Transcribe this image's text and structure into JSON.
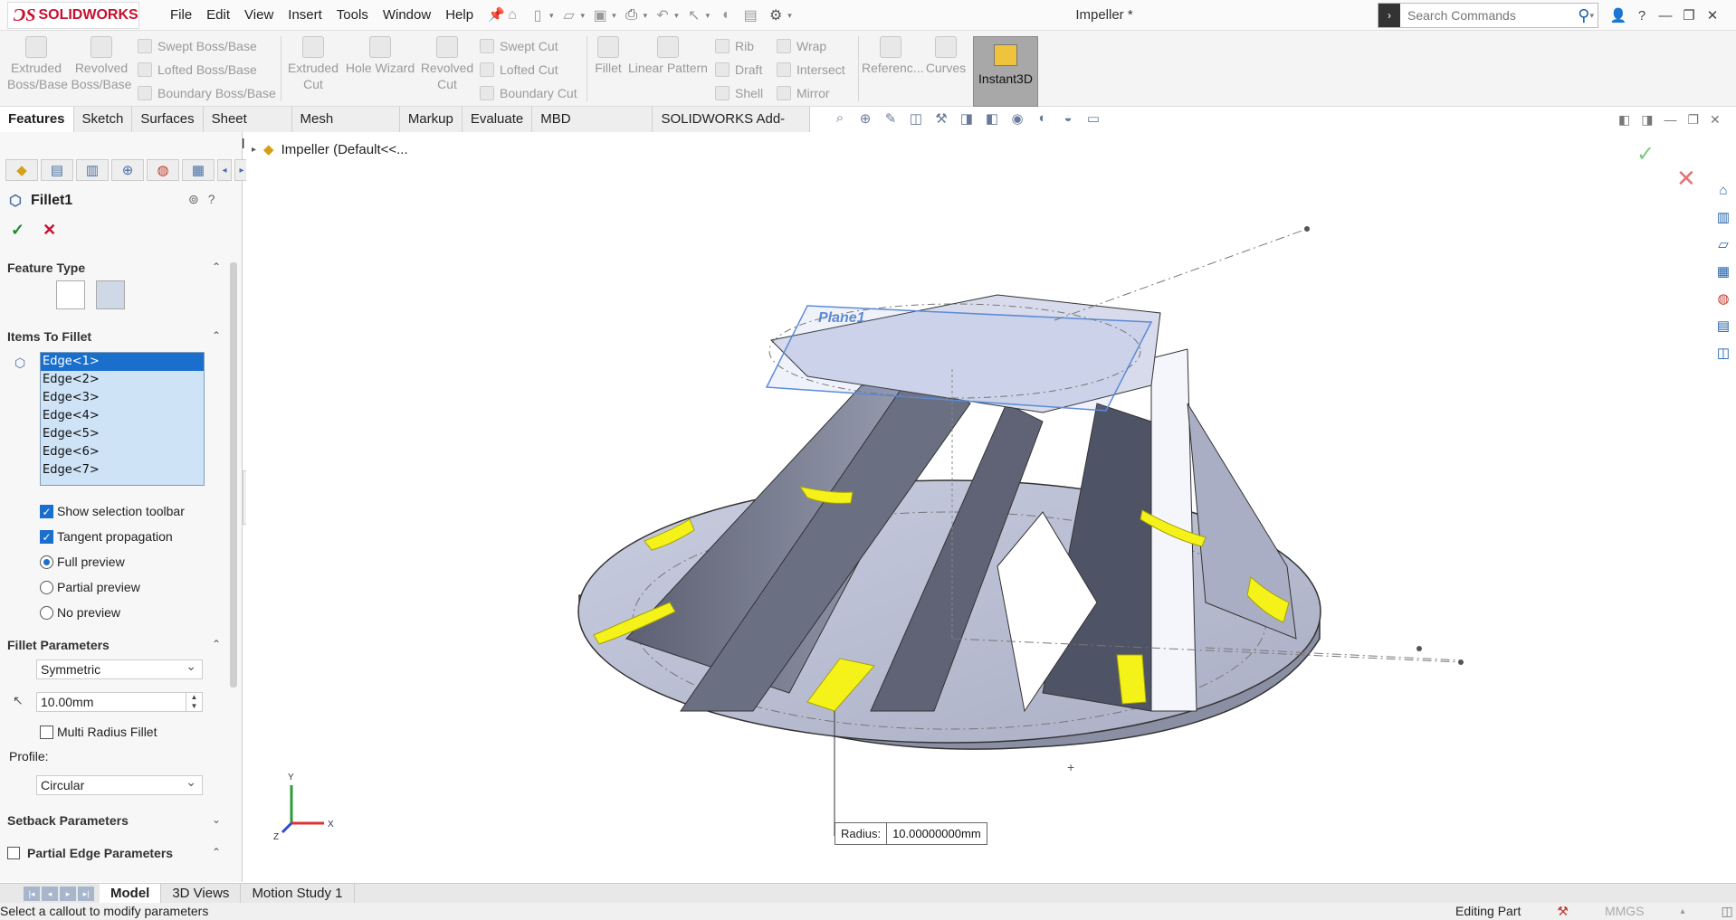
{
  "app": {
    "logo_text": "SOLIDWORKS",
    "document_title": "Impeller *",
    "menu": [
      "File",
      "Edit",
      "View",
      "Insert",
      "Tools",
      "Window",
      "Help"
    ],
    "search_placeholder": "Search Commands"
  },
  "command_manager": {
    "buttons": {
      "extruded_boss": "Extruded\nBoss/Base",
      "revolved_boss": "Revolved\nBoss/Base",
      "swept_boss": "Swept Boss/Base",
      "lofted_boss": "Lofted Boss/Base",
      "boundary_boss": "Boundary Boss/Base",
      "extruded_cut": "Extruded\nCut",
      "hole_wizard": "Hole Wizard",
      "revolved_cut": "Revolved\nCut",
      "swept_cut": "Swept Cut",
      "lofted_cut": "Lofted Cut",
      "boundary_cut": "Boundary Cut",
      "fillet": "Fillet",
      "linear_pattern": "Linear Pattern",
      "rib": "Rib",
      "draft": "Draft",
      "shell": "Shell",
      "wrap": "Wrap",
      "intersect": "Intersect",
      "mirror": "Mirror",
      "reference": "Referenc...",
      "curves": "Curves",
      "instant3d": "Instant3D"
    },
    "tabs": [
      "Features",
      "Sketch",
      "Surfaces",
      "Sheet Metal",
      "Mesh Modeling",
      "Markup",
      "Evaluate",
      "MBD Dimensions",
      "SOLIDWORKS Add-Ins"
    ],
    "active_tab": "Features"
  },
  "property_manager": {
    "feature_name": "Fillet1",
    "sections": {
      "feature_type": "Feature Type",
      "items_to_fillet": "Items To Fillet",
      "fillet_parameters": "Fillet Parameters",
      "setback_parameters": "Setback Parameters",
      "partial_edge_parameters": "Partial Edge Parameters",
      "profile_label": "Profile:"
    },
    "edges": [
      "Edge<1>",
      "Edge<2>",
      "Edge<3>",
      "Edge<4>",
      "Edge<5>",
      "Edge<6>",
      "Edge<7>"
    ],
    "options": {
      "show_selection_toolbar": "Show selection toolbar",
      "tangent_propagation": "Tangent propagation",
      "full_preview": "Full preview",
      "partial_preview": "Partial preview",
      "no_preview": "No preview",
      "multi_radius_fillet": "Multi Radius Fillet"
    },
    "fillet_method": "Symmetric",
    "radius": "10.00mm",
    "profile": "Circular"
  },
  "viewport": {
    "tree_root": "Impeller  (Default<<...",
    "plane_label": "Plane1",
    "radius_callout_label": "Radius:",
    "radius_callout_value": "10.00000000mm",
    "triad": {
      "x": "X",
      "y": "Y",
      "z": "Z"
    }
  },
  "bottom_tabs": [
    "Model",
    "3D Views",
    "Motion Study 1"
  ],
  "active_bottom_tab": "Model",
  "status": {
    "message": "Select a callout to modify parameters",
    "mode": "Editing Part",
    "units": "MMGS"
  },
  "colors": {
    "brand_red": "#c8102e",
    "selection_blue": "#1a6fcc",
    "fillet_preview_yellow": "#f5f21a",
    "model_gray": "#8a8fa3"
  }
}
